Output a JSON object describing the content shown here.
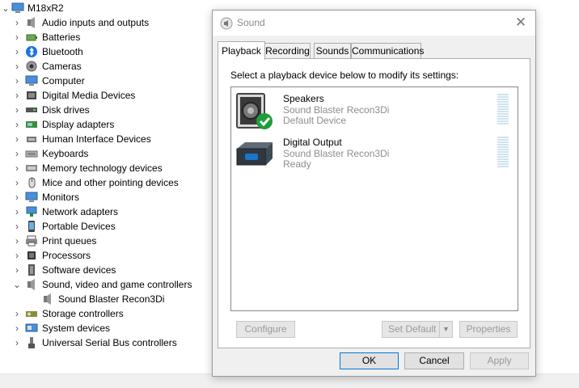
{
  "device_manager": {
    "computer_name": "M18xR2",
    "categories": [
      {
        "label": "Audio inputs and outputs",
        "icon": "speaker-icon"
      },
      {
        "label": "Batteries",
        "icon": "battery-icon"
      },
      {
        "label": "Bluetooth",
        "icon": "bluetooth-icon"
      },
      {
        "label": "Cameras",
        "icon": "camera-icon"
      },
      {
        "label": "Computer",
        "icon": "monitor-icon"
      },
      {
        "label": "Digital Media Devices",
        "icon": "media-device-icon"
      },
      {
        "label": "Disk drives",
        "icon": "disk-icon"
      },
      {
        "label": "Display adapters",
        "icon": "display-adapter-icon"
      },
      {
        "label": "Human Interface Devices",
        "icon": "hid-icon"
      },
      {
        "label": "Keyboards",
        "icon": "keyboard-icon"
      },
      {
        "label": "Memory technology devices",
        "icon": "memory-icon"
      },
      {
        "label": "Mice and other pointing devices",
        "icon": "mouse-icon"
      },
      {
        "label": "Monitors",
        "icon": "monitor-icon"
      },
      {
        "label": "Network adapters",
        "icon": "network-icon"
      },
      {
        "label": "Portable Devices",
        "icon": "portable-device-icon"
      },
      {
        "label": "Print queues",
        "icon": "printer-icon"
      },
      {
        "label": "Processors",
        "icon": "processor-icon"
      },
      {
        "label": "Software devices",
        "icon": "software-device-icon"
      },
      {
        "label": "Sound, video and game controllers",
        "icon": "speaker-icon",
        "expanded": true,
        "children": [
          {
            "label": "Sound Blaster Recon3Di",
            "icon": "speaker-icon"
          }
        ]
      },
      {
        "label": "Storage controllers",
        "icon": "storage-icon"
      },
      {
        "label": "System devices",
        "icon": "system-icon"
      },
      {
        "label": "Universal Serial Bus controllers",
        "icon": "usb-icon"
      }
    ]
  },
  "sound_dialog": {
    "title": "Sound",
    "close_glyph": "✕",
    "tabs": [
      {
        "label": "Playback",
        "active": true
      },
      {
        "label": "Recording",
        "active": false
      },
      {
        "label": "Sounds",
        "active": false
      },
      {
        "label": "Communications",
        "active": false
      }
    ],
    "instructions": "Select a playback device below to modify its settings:",
    "devices": [
      {
        "name": "Speakers",
        "description": "Sound Blaster Recon3Di",
        "status": "Default Device",
        "icon": "speaker-icon",
        "is_default": true
      },
      {
        "name": "Digital Output",
        "description": "Sound Blaster Recon3Di",
        "status": "Ready",
        "icon": "digital-output-icon",
        "is_default": false
      }
    ],
    "buttons": {
      "configure": "Configure",
      "set_default": "Set Default",
      "properties": "Properties",
      "ok": "OK",
      "cancel": "Cancel",
      "apply": "Apply"
    },
    "colors": {
      "accent": "#0078d7",
      "default_check": "#1e9e3a",
      "level_meter": "#cfe3ee"
    }
  }
}
